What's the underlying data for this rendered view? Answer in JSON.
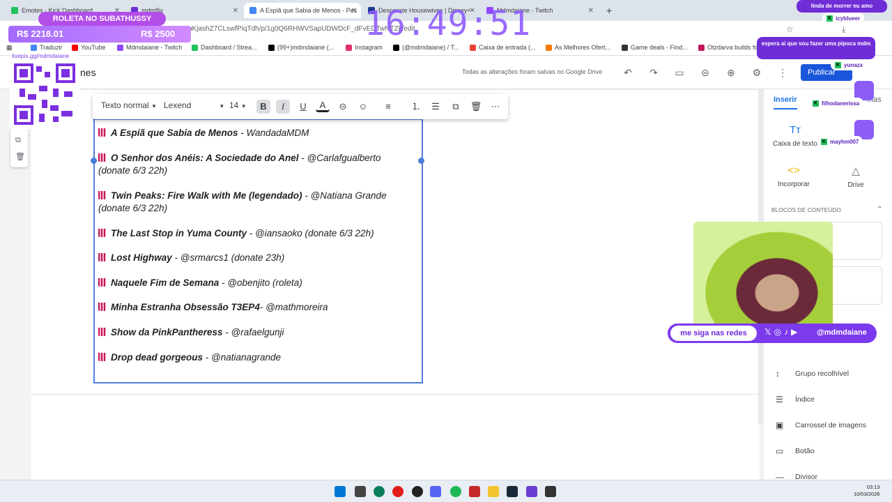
{
  "browser": {
    "tabs": [
      {
        "title": "Emotes - Kick Dashboard",
        "color": "#21c25e"
      },
      {
        "title": "mdmflix",
        "color": "#6f2dd6"
      },
      {
        "title": "A Espiã que Sabia de Menos - Pes",
        "color": "#4285f4"
      },
      {
        "title": "Desperate Housewives | Disney+",
        "color": "#1b3b8c"
      },
      {
        "title": "Mdmdaiane - Twitch",
        "color": "#9146ff"
      }
    ],
    "url": "uKjashZ7CLswfPiqTdh/p/1g0Q6RHWVSapUDWDcF_dFvEDTwNTZk/edit",
    "bookmarks": [
      {
        "label": "Traduzir",
        "color": "#4285f4"
      },
      {
        "label": "YouTube",
        "color": "#ff0000"
      },
      {
        "label": "Mdmdaiane - Twitch",
        "color": "#9146ff"
      },
      {
        "label": "Dashboard / Strea...",
        "color": "#21c25e"
      },
      {
        "label": "(99+)mdmdaiane (...",
        "color": "#000000"
      },
      {
        "label": "Instagram",
        "color": "#e1306c"
      },
      {
        "label": "(@mdmdaiane) / T...",
        "color": "#000000"
      },
      {
        "label": "Caixa de entrada (...",
        "color": "#ea4335"
      },
      {
        "label": "As Melhores Ofert...",
        "color": "#f57c00"
      },
      {
        "label": "Game deals - Find...",
        "color": "#333333"
      },
      {
        "label": "Otzdarva builds fo",
        "color": "#c2185b"
      }
    ]
  },
  "sites": {
    "title": "nes",
    "save_status": "Todas as alterações foram salvas no Google Drive",
    "publish_label": "Publicar"
  },
  "format_toolbar": {
    "style": "Texto normal",
    "font": "Lexend",
    "size": "14"
  },
  "content": {
    "items": [
      {
        "title": "A Espiã que Sabia de Menos",
        "rest": " - WandadaMDM"
      },
      {
        "title": "O Senhor dos Anéis: A Sociedade do Anel",
        "rest": " - @Carlafgualberto",
        "line2": "(donate 6/3 22h)"
      },
      {
        "title": "Twin Peaks: Fire Walk with Me (legendado)",
        "rest": " - @Natiana Grande",
        "line2": "(donate 6/3 22h)"
      },
      {
        "title": "The Last Stop in Yuma County",
        "rest": " - @iansaoko (donate 6/3 22h)"
      },
      {
        "title": "Lost Highway",
        "rest": " - @srmarcs1 (donate 23h)"
      },
      {
        "title": "Naquele Fim de Semana",
        "rest": " - @obenjito (roleta)"
      },
      {
        "title": "Minha Estranha Obsessão T3EP4",
        "rest": "- @mathmoreira"
      },
      {
        "title": "Show da PinkPantheress",
        "rest": " - @rafaelgunji"
      },
      {
        "title": "Drop dead gorgeous",
        "rest": " - @natianagrande"
      }
    ]
  },
  "panel": {
    "tabs": [
      "Inserir",
      "mas"
    ],
    "insert_items": [
      "Caixa de texto",
      "Incorporar",
      "Drive"
    ],
    "blocks_label": "BLOCOS DE CONTEÚDO",
    "list": [
      "Grupo recolhível",
      "Índice",
      "Carrossel de imagens",
      "Botão",
      "Divisor"
    ]
  },
  "taskbar": {
    "time": "03:13",
    "date": "10/03/2026"
  },
  "overlay": {
    "roleta": "ROLETA NO SUBATHUSSY",
    "money_current": "R$ 2218.01",
    "money_goal": "R$ 2500",
    "big_clock": "16:49:51",
    "livepix_url": "livepix.gg/mdmdaiane",
    "chat": [
      {
        "msg": "linda de morrer eu amo",
        "user": "icyblueer"
      },
      {
        "msg": "espera ai que vou fazer uma pipoca mdm",
        "user": "yunazx"
      }
    ],
    "users": [
      "filhodanerissa",
      "mayhm007"
    ],
    "socials_left": "me siga nas redes",
    "socials_right": "@mdmdaiane"
  }
}
